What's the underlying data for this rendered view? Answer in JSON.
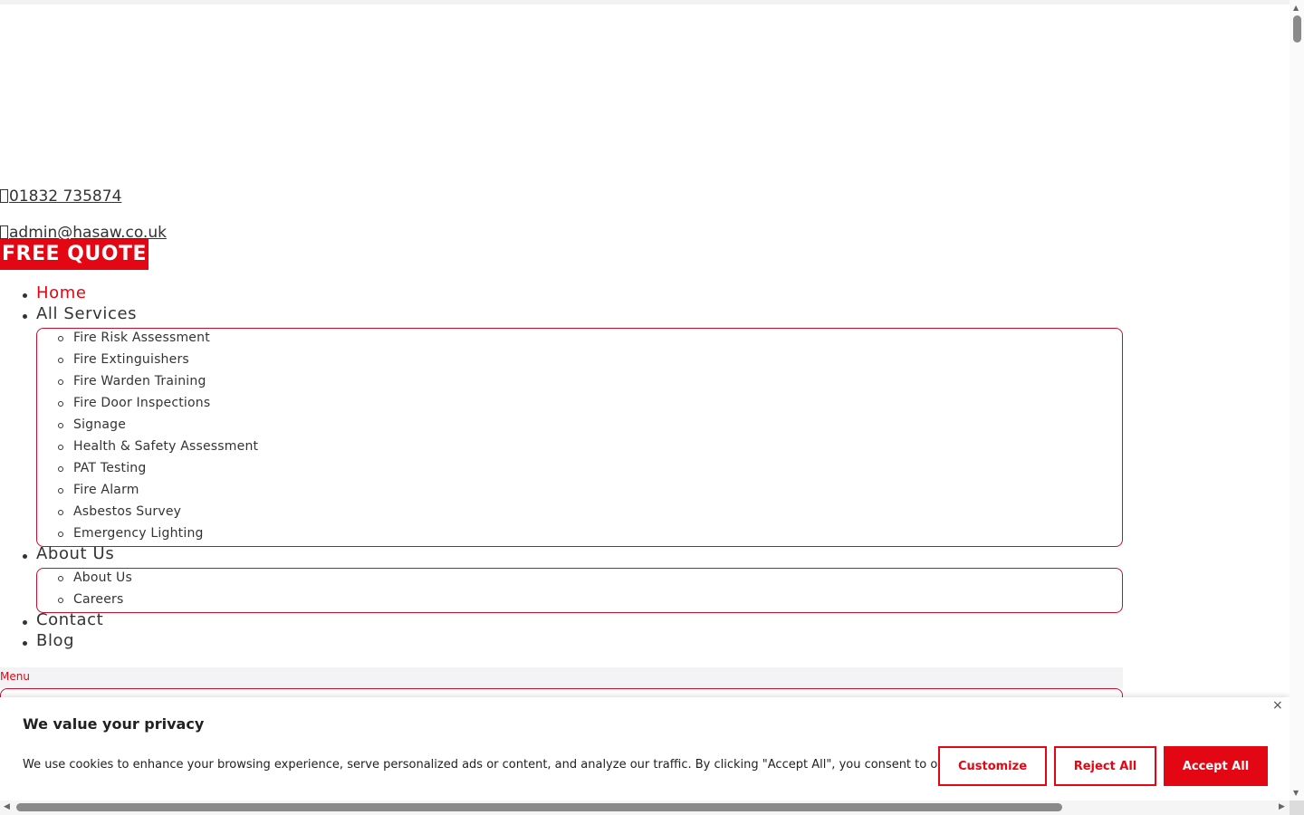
{
  "contact": {
    "phone": "01832 735874",
    "email": "admin@hasaw.co.uk"
  },
  "cta": {
    "free_quote": "FREE QUOTE"
  },
  "nav": {
    "home": "Home",
    "all_services": "All Services",
    "services": [
      "Fire Risk Assessment",
      "Fire Extinguishers",
      "Fire Warden Training",
      "Fire Door Inspections",
      "Signage",
      "Health & Safety Assessment",
      "PAT Testing",
      "Fire Alarm",
      "Asbestos Survey",
      "Emergency Lighting"
    ],
    "about_us": "About Us",
    "about_sub": [
      "About Us",
      "Careers"
    ],
    "contact": "Contact",
    "blog": "Blog",
    "menu_label": "Menu"
  },
  "cookie": {
    "title": "We value your privacy",
    "text": "We use cookies to enhance your browsing experience, serve personalized ads or content, and analyze our traffic. By clicking \"Accept All\", you consent to our use of cookies.",
    "close": "×",
    "customize": "Customize",
    "reject": "Reject All",
    "accept": "Accept All"
  },
  "colors": {
    "brand_red": "#e30613",
    "border_red": "#c8102e"
  },
  "icons": {
    "phone": "phone-icon",
    "email": "email-icon"
  }
}
